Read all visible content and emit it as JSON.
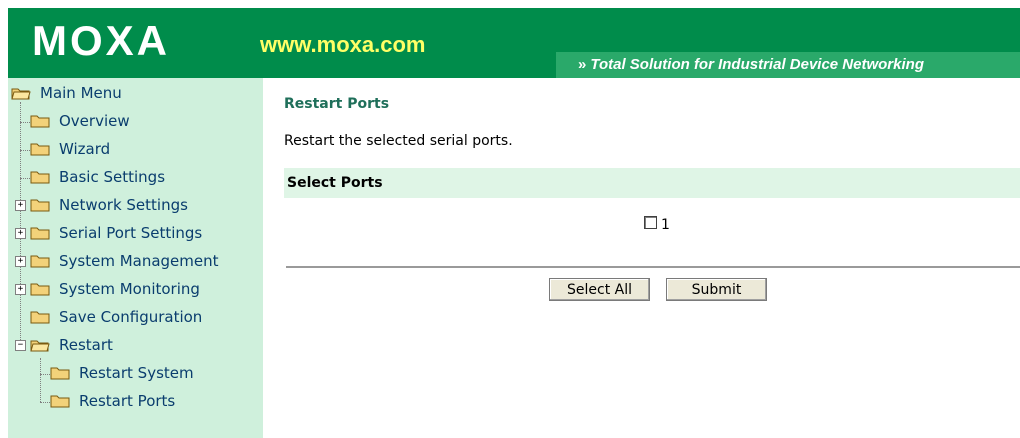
{
  "header": {
    "logo": "MOXA",
    "site": "www.moxa.com",
    "tagline_arrows": "»",
    "tagline": "Total Solution for Industrial Device Networking"
  },
  "sidebar": {
    "items": [
      {
        "label": "Main Menu"
      },
      {
        "label": "Overview"
      },
      {
        "label": "Wizard"
      },
      {
        "label": "Basic Settings"
      },
      {
        "label": "Network Settings",
        "expander": "+"
      },
      {
        "label": "Serial Port Settings",
        "expander": "+"
      },
      {
        "label": "System Management",
        "expander": "+"
      },
      {
        "label": "System Monitoring",
        "expander": "+"
      },
      {
        "label": "Save Configuration"
      },
      {
        "label": "Restart",
        "expander": "−"
      },
      {
        "label": "Restart System"
      },
      {
        "label": "Restart Ports"
      }
    ]
  },
  "main": {
    "title": "Restart Ports",
    "description": "Restart the selected serial ports.",
    "section_title": "Select Ports",
    "ports": [
      {
        "label": "1",
        "checked": false
      }
    ],
    "buttons": {
      "select_all": "Select All",
      "submit": "Submit"
    }
  },
  "colors": {
    "header_green": "#008c4b",
    "site_yellow": "#ffff66",
    "sidebar_bg": "#cff0dc",
    "link_blue": "#0a3d6e",
    "title_green": "#1f6f5a"
  }
}
